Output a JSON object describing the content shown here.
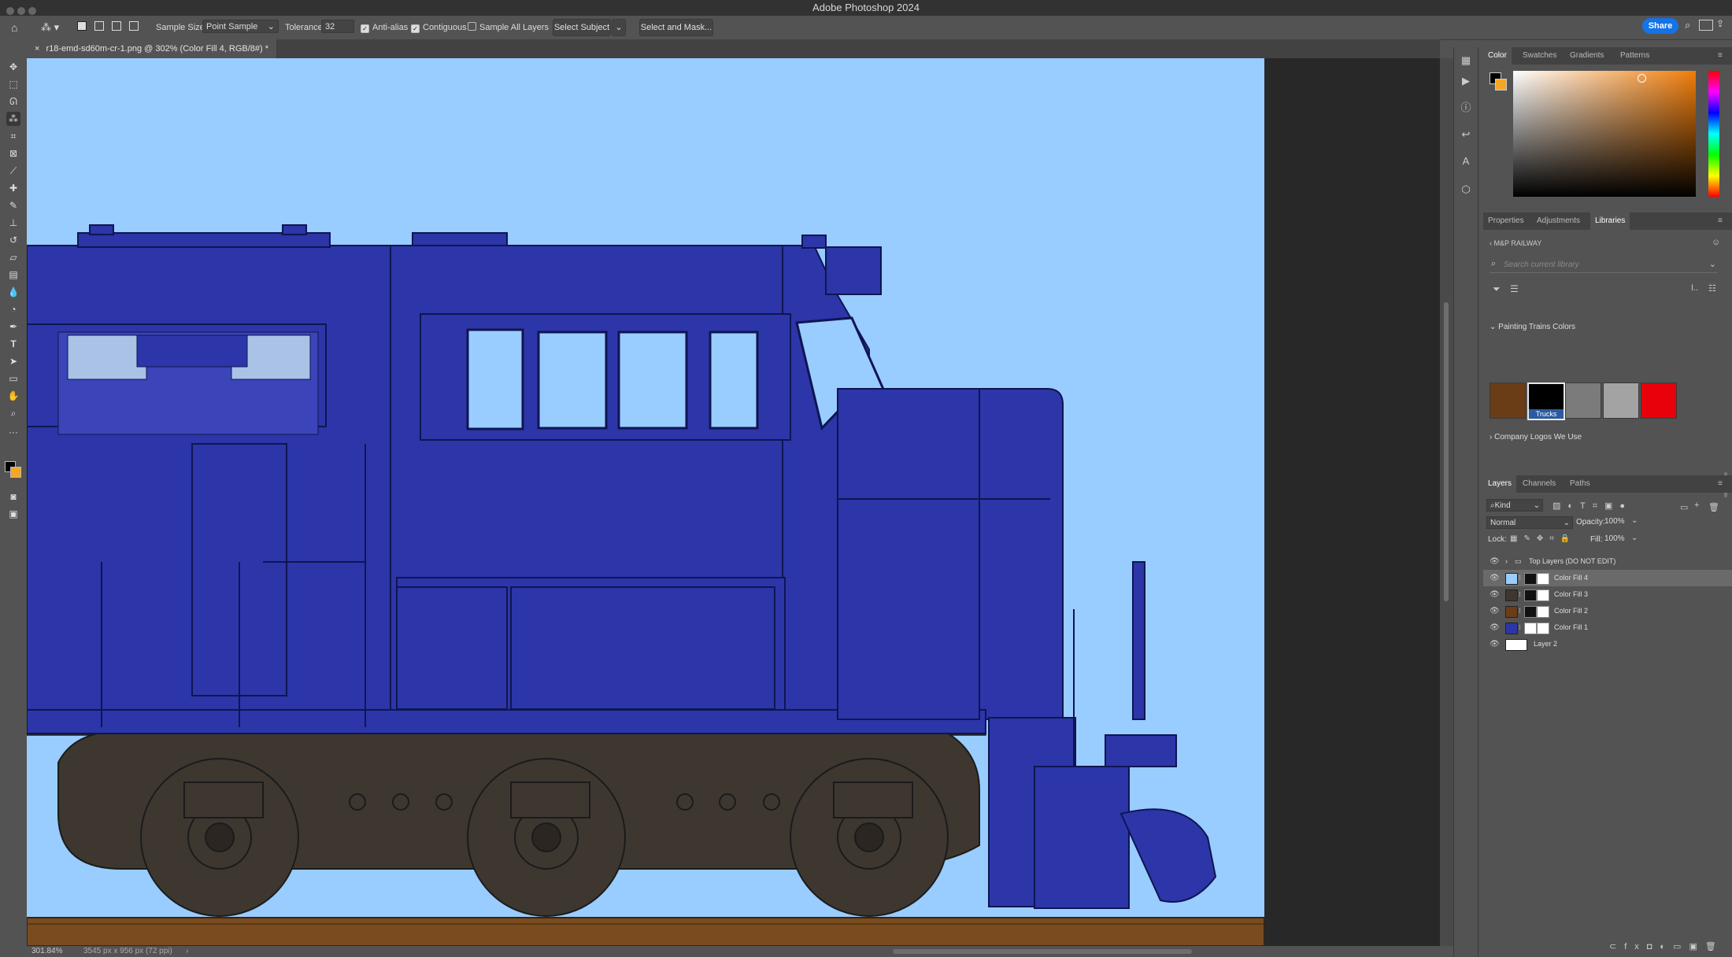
{
  "app": {
    "title": "Adobe Photoshop 2024",
    "share_label": "Share"
  },
  "options_bar": {
    "sample_size_label": "Sample Size:",
    "sample_size_value": "Point Sample",
    "tolerance_label": "Tolerance:",
    "tolerance_value": "32",
    "anti_alias_label": "Anti-alias",
    "contiguous_label": "Contiguous",
    "sample_all_layers_label": "Sample All Layers",
    "select_subject_label": "Select Subject",
    "select_and_mask_label": "Select and Mask..."
  },
  "document": {
    "tab_close": "×",
    "tab_title": "r18-emd-sd60m-cr-1.png @ 302% (Color Fill 4, RGB/8#) *"
  },
  "status": {
    "zoom": "301.84%",
    "doc_info": "3545 px x 956 px (72 ppi)",
    "arrow": "›"
  },
  "panels": {
    "color_tabs": [
      "Color",
      "Swatches",
      "Gradients",
      "Patterns"
    ],
    "properties_tabs": [
      "Properties",
      "Adjustments",
      "Libraries"
    ],
    "library": {
      "back": "‹",
      "name": "M&P RAILWAY",
      "search_placeholder": "Search current library",
      "group1_title": "Painting Trains Colors",
      "group1_arrow": "⌄",
      "group2_title": "Company Logos We Use",
      "group2_arrow": "›",
      "swatch_tooltip": "Trucks",
      "swatches": [
        "#6b3d17",
        "#000000",
        "#7b7b7b",
        "#a3a3a3",
        "#e8000b"
      ]
    },
    "layers_tabs": [
      "Layers",
      "Channels",
      "Paths"
    ],
    "layers_filter": "Kind",
    "blend_mode": "Normal",
    "opacity_label": "Opacity:",
    "opacity_value": "100%",
    "lock_label": "Lock:",
    "fill_label": "Fill:",
    "fill_value": "100%",
    "layers": [
      {
        "name": "Top Layers (DO NOT EDIT)"
      },
      {
        "name": "Color Fill 4"
      },
      {
        "name": "Color Fill 3"
      },
      {
        "name": "Color Fill 2"
      },
      {
        "name": "Color Fill 1"
      },
      {
        "name": "Layer 2"
      }
    ]
  },
  "colors": {
    "canvas_bg": "#99ccff",
    "locomotive_blue": "#2c36a8",
    "trucks_brown": "#3d3730",
    "rail_brown": "#7a4b1e",
    "accent": "#1473e6"
  }
}
